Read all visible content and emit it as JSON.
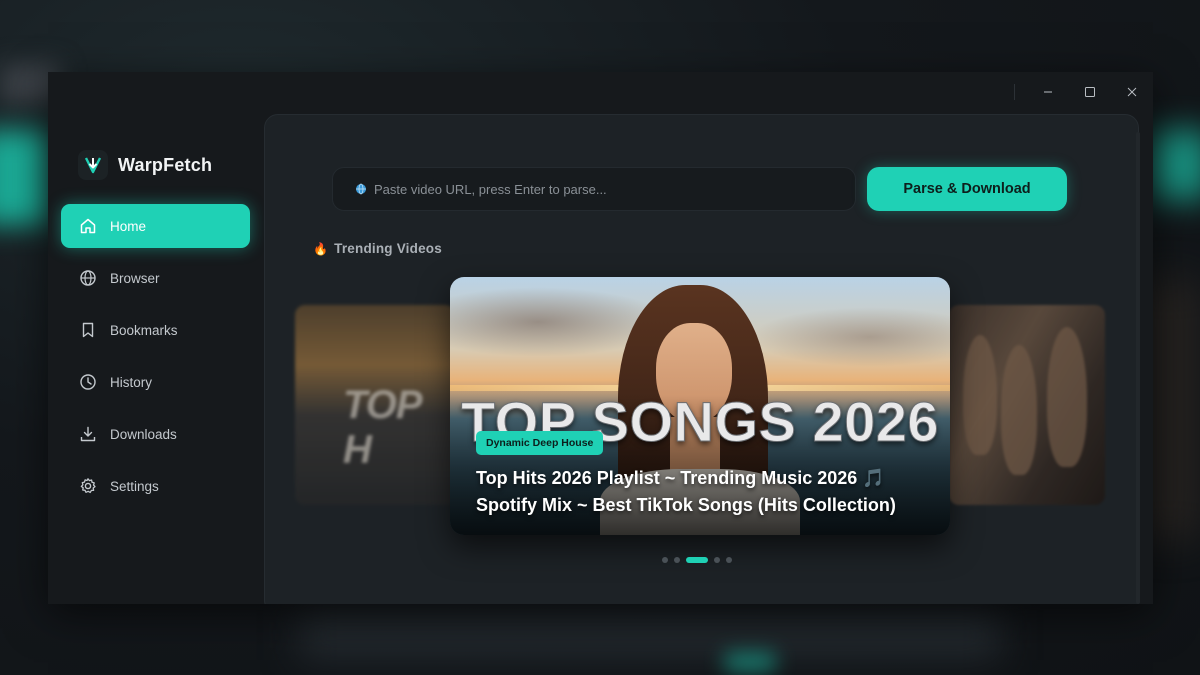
{
  "app": {
    "name": "WarpFetch",
    "accent_color": "#1fd1b5",
    "window_controls": [
      "minimize",
      "maximize",
      "close"
    ]
  },
  "sidebar": {
    "items": [
      {
        "label": "Home",
        "icon": "home-icon",
        "active": true
      },
      {
        "label": "Browser",
        "icon": "globe-icon",
        "active": false
      },
      {
        "label": "Bookmarks",
        "icon": "bookmark-icon",
        "active": false
      },
      {
        "label": "History",
        "icon": "clock-icon",
        "active": false
      },
      {
        "label": "Downloads",
        "icon": "download-icon",
        "active": false
      },
      {
        "label": "Settings",
        "icon": "gear-icon",
        "active": false
      }
    ]
  },
  "search": {
    "placeholder": "Paste video URL, press Enter to parse...",
    "value": "",
    "button_label": "Parse & Download"
  },
  "trending": {
    "title": "Trending Videos",
    "featured": {
      "thumbnail_title": "TOP SONGS 2026",
      "tag": "Dynamic Deep House",
      "caption": "Top Hits 2026 Playlist ~ Trending Music 2026 🎵 Spotify Mix ~ Best TikTok Songs (Hits Collection)"
    },
    "side_left_text": "TOP H",
    "pagination": {
      "count": 5,
      "active_index": 2
    }
  }
}
